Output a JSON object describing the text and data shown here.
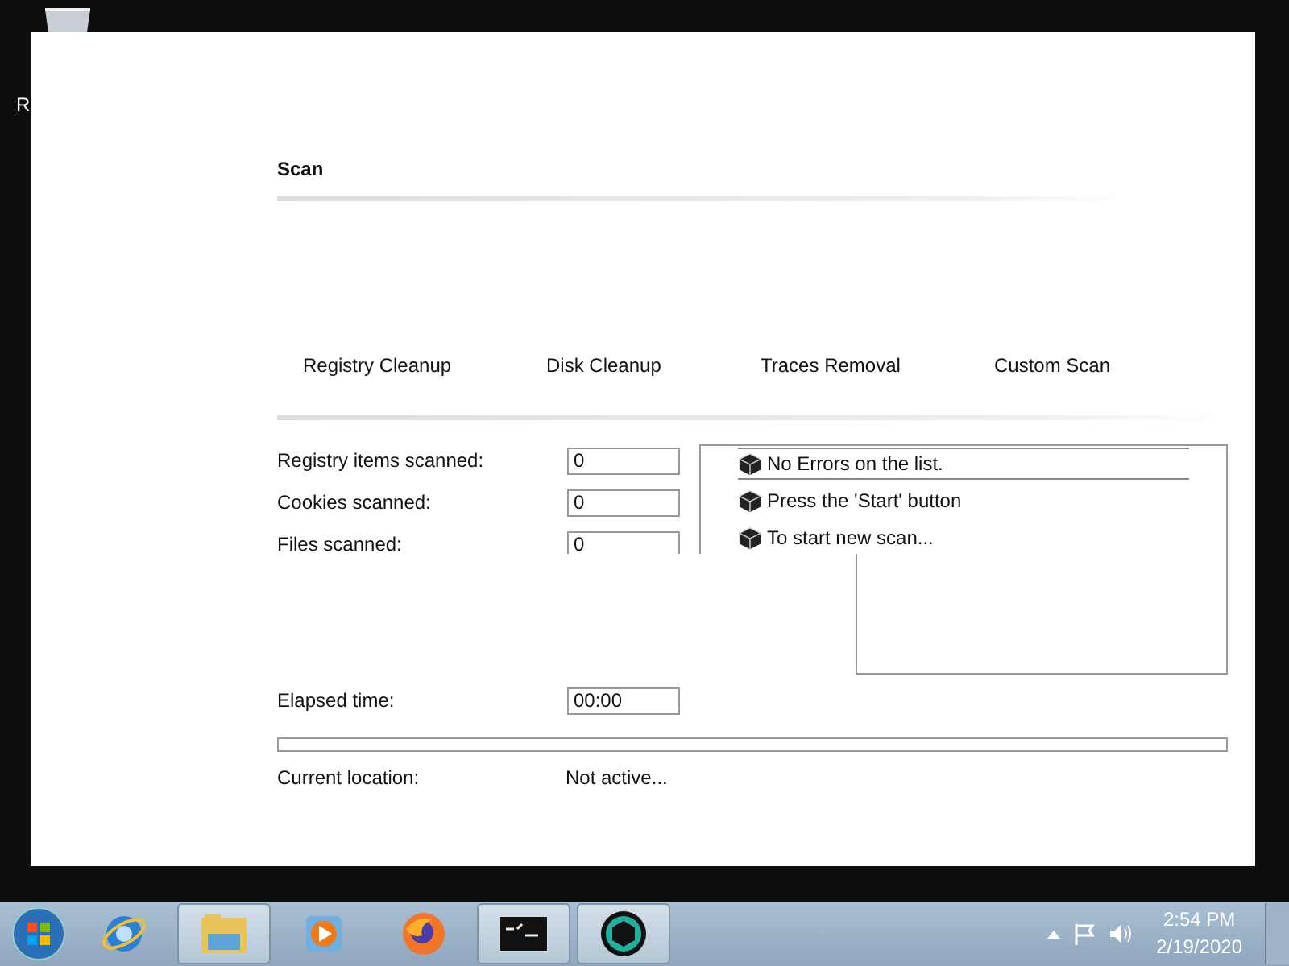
{
  "desktop_icons": [
    {
      "label": "R"
    }
  ],
  "window": {
    "section_title": "Scan",
    "tabs": [
      {
        "label": "Registry Cleanup",
        "selected": false
      },
      {
        "label": "Disk Cleanup",
        "selected": false
      },
      {
        "label": "Traces Removal",
        "selected": false
      },
      {
        "label": "Custom Scan",
        "selected": false
      }
    ],
    "stats": [
      {
        "label": "Registry items scanned:",
        "value": "0"
      },
      {
        "label": "Cookies scanned:",
        "value": "0"
      },
      {
        "label": "Files scanned:",
        "value": "0"
      }
    ],
    "log": [
      {
        "text": "No Errors on the list.",
        "selected": true
      },
      {
        "text": "Press the 'Start' button",
        "selected": false
      },
      {
        "text": "To start new scan...",
        "selected": false
      }
    ],
    "elapsed": {
      "label": "Elapsed time:",
      "value": "00:00"
    },
    "progress": {
      "level": 0
    },
    "location": {
      "label": "Current location:",
      "value": "Not active..."
    }
  },
  "taskbar": {
    "apps": [
      {
        "kind": "ie",
        "active": false
      },
      {
        "kind": "folder",
        "active": true
      },
      {
        "kind": "media",
        "active": false
      },
      {
        "kind": "firefox",
        "active": false
      },
      {
        "kind": "console",
        "active": true
      },
      {
        "kind": "cube",
        "active": true
      }
    ],
    "time": "2:54 PM",
    "date": "2/19/2020"
  }
}
